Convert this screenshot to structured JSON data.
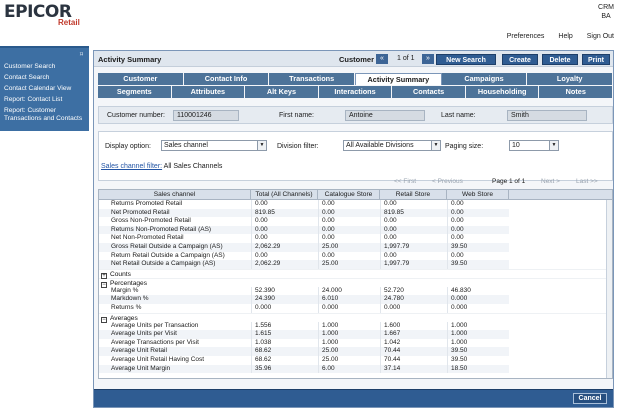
{
  "header": {
    "brand": "EPICOR",
    "brand_sub": "Retail",
    "crm_line1": "CRM",
    "crm_line2": "BA",
    "nav": [
      "Preferences",
      "Help",
      "Sign Out"
    ]
  },
  "sidebar": {
    "pin_icon": "pin-icon",
    "items": [
      "Customer Search",
      "Contact Search",
      "Contact Calendar View",
      "Report: Contact List",
      "Report: Customer Transactions and Contacts"
    ]
  },
  "titlebar": {
    "title": "Activity Summary",
    "customer_label": "Customer",
    "pager_text": "1 of 1",
    "buttons": [
      "New Search",
      "Create",
      "Delete",
      "Print"
    ]
  },
  "tabs": {
    "row1": [
      "Customer",
      "Contact Info",
      "Transactions",
      "Activity Summary",
      "Campaigns",
      "Loyalty"
    ],
    "row2": [
      "Segments",
      "Attributes",
      "Alt Keys",
      "Interactions",
      "Contacts",
      "Householding",
      "Notes"
    ],
    "active": "Activity Summary"
  },
  "customer_info": {
    "number_label": "Customer number:",
    "number_value": "110001246",
    "first_label": "First name:",
    "first_value": "Antoine",
    "last_label": "Last name:",
    "last_value": "Smith"
  },
  "filters": {
    "display_label": "Display option:",
    "display_value": "Sales channel",
    "division_label": "Division filter:",
    "division_value": "All Available Divisions",
    "paging_label": "Paging size:",
    "paging_value": "10",
    "channel_filter_link": "Sales channel filter:",
    "channel_filter_value": "All Sales Channels"
  },
  "grid_pager": {
    "first": "<< First",
    "previous": "< Previous",
    "page": "Page 1 of 1",
    "next": "Next >",
    "last": "Last >>"
  },
  "grid": {
    "columns": [
      "Sales channel",
      "Total (All Channels)",
      "Catalogue Store",
      "Retail Store",
      "Web Store"
    ],
    "section1": [
      [
        "Returns Promoted Retail",
        "0.00",
        "0.00",
        "0.00",
        "0.00"
      ],
      [
        "Net Promoted Retail",
        "819.85",
        "0.00",
        "819.85",
        "0.00"
      ],
      [
        "Gross Non-Promoted Retail",
        "0.00",
        "0.00",
        "0.00",
        "0.00"
      ],
      [
        "Returns Non-Promoted Retail (AS)",
        "0.00",
        "0.00",
        "0.00",
        "0.00"
      ],
      [
        "Net Non-Promoted Retail",
        "0.00",
        "0.00",
        "0.00",
        "0.00"
      ],
      [
        "Gross Retail Outside a Campaign (AS)",
        "2,062.29",
        "25.00",
        "1,997.79",
        "39.50"
      ],
      [
        "Return Retail Outside a Campaign (AS)",
        "0.00",
        "0.00",
        "0.00",
        "0.00"
      ],
      [
        "Net Retail Outside a Campaign (AS)",
        "2,062.29",
        "25.00",
        "1,997.79",
        "39.50"
      ]
    ],
    "group_counts": "Counts",
    "group_percentages": "Percentages",
    "percentages": [
      [
        "Margin %",
        "52.390",
        "24.000",
        "52.720",
        "46.830"
      ],
      [
        "Markdown %",
        "24.390",
        "6.010",
        "24.780",
        "0.000"
      ],
      [
        "Returns %",
        "0.000",
        "0.000",
        "0.000",
        "0.000"
      ]
    ],
    "group_averages": "Averages",
    "averages": [
      [
        "Average Units per Transaction",
        "1.556",
        "1.000",
        "1.600",
        "1.000"
      ],
      [
        "Average Units per Visit",
        "1.615",
        "1.000",
        "1.667",
        "1.000"
      ],
      [
        "Average Transactions per Visit",
        "1.038",
        "1.000",
        "1.042",
        "1.000"
      ],
      [
        "Average Unit Retail",
        "68.62",
        "25.00",
        "70.44",
        "39.50"
      ],
      [
        "Average Unit Retail Having Cost",
        "68.62",
        "25.00",
        "70.44",
        "39.50"
      ],
      [
        "Average Unit Margin",
        "35.96",
        "6.00",
        "37.14",
        "18.50"
      ]
    ]
  },
  "footer": {
    "cancel": "Cancel"
  }
}
